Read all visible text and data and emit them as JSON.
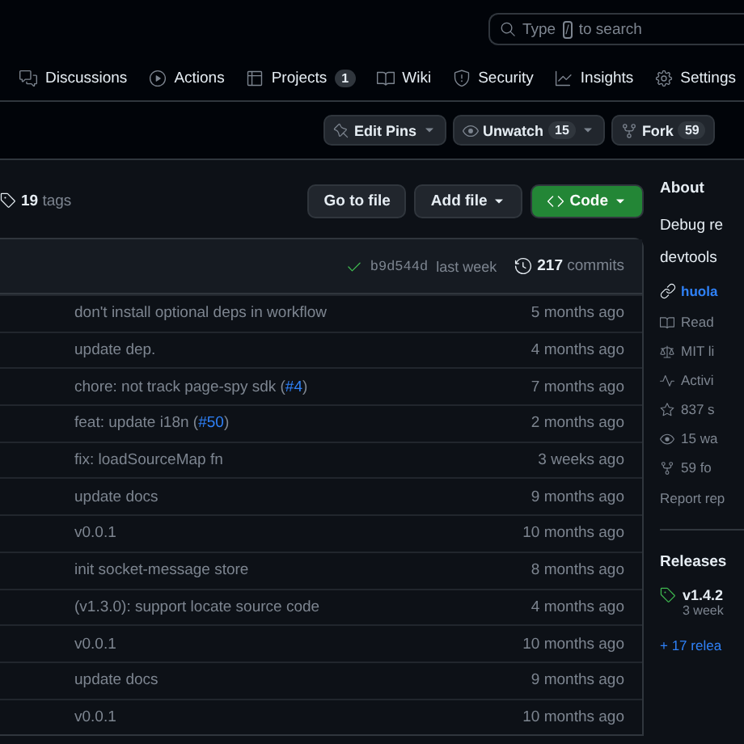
{
  "search": {
    "prefix": "Type",
    "key": "/",
    "suffix": "to search"
  },
  "repo_nav": [
    {
      "kind": "discussions",
      "label": "Discussions",
      "selected": false
    },
    {
      "kind": "actions",
      "label": "Actions",
      "selected": false
    },
    {
      "kind": "projects",
      "label": "Projects",
      "count": "1",
      "selected": false
    },
    {
      "kind": "wiki",
      "label": "Wiki",
      "selected": false
    },
    {
      "kind": "security",
      "label": "Security",
      "selected": false
    },
    {
      "kind": "insights",
      "label": "Insights",
      "selected": false
    },
    {
      "kind": "settings",
      "label": "Settings",
      "selected": false
    }
  ],
  "repo_actions": [
    {
      "kind": "pin",
      "label": "Edit Pins"
    },
    {
      "kind": "watch",
      "label": "Unwatch",
      "count": "15"
    },
    {
      "kind": "fork",
      "label": "Fork",
      "count": "59"
    }
  ],
  "tags": {
    "count": "19",
    "label": "tags"
  },
  "file_buttons": [
    {
      "kind": "plain",
      "label": "Go to file"
    },
    {
      "kind": "menu",
      "label": "Add file"
    },
    {
      "kind": "primary",
      "label": "Code"
    }
  ],
  "latest_commit": {
    "checks_passed": true,
    "hash": "b9d544d",
    "time": "last week",
    "commits_count": "217",
    "commits_label": "commits"
  },
  "files": [
    {
      "message": "don't install optional deps in workflow",
      "time": "5 months ago"
    },
    {
      "message": "update dep.",
      "time": "4 months ago"
    },
    {
      "message": "chore: not track page-spy sdk (",
      "link": "#4",
      "message_end": ")",
      "time": "7 months ago"
    },
    {
      "message": "feat: update i18n (",
      "link": "#50",
      "message_end": ")",
      "time": "2 months ago"
    },
    {
      "message": "fix: loadSourceMap fn",
      "time": "3 weeks ago"
    },
    {
      "message": "update docs",
      "time": "9 months ago"
    },
    {
      "message": "v0.0.1",
      "time": "10 months ago"
    },
    {
      "message": "init socket-message store",
      "time": "8 months ago"
    },
    {
      "message": "(v1.3.0): support locate source code",
      "time": "4 months ago"
    },
    {
      "message": "v0.0.1",
      "time": "10 months ago"
    },
    {
      "message": "update docs",
      "time": "9 months ago"
    },
    {
      "message": "v0.0.1",
      "time": "10 months ago"
    }
  ],
  "about": {
    "title": "About",
    "description_lines": [
      "Debug re",
      "devtools"
    ],
    "website": "huola",
    "items": [
      {
        "kind": "readme",
        "label": "Read"
      },
      {
        "kind": "license",
        "label": "MIT li"
      },
      {
        "kind": "activity",
        "label": "Activi"
      },
      {
        "kind": "stars",
        "label": "837 s"
      },
      {
        "kind": "watchers",
        "label": "15 wa"
      },
      {
        "kind": "forks",
        "label": "59 fo"
      },
      {
        "kind": "report",
        "label": "Report rep"
      }
    ]
  },
  "releases": {
    "title": "Releases",
    "latest": {
      "tag": "v1.4.2",
      "time": "3 week"
    },
    "more": "+ 17 relea"
  }
}
